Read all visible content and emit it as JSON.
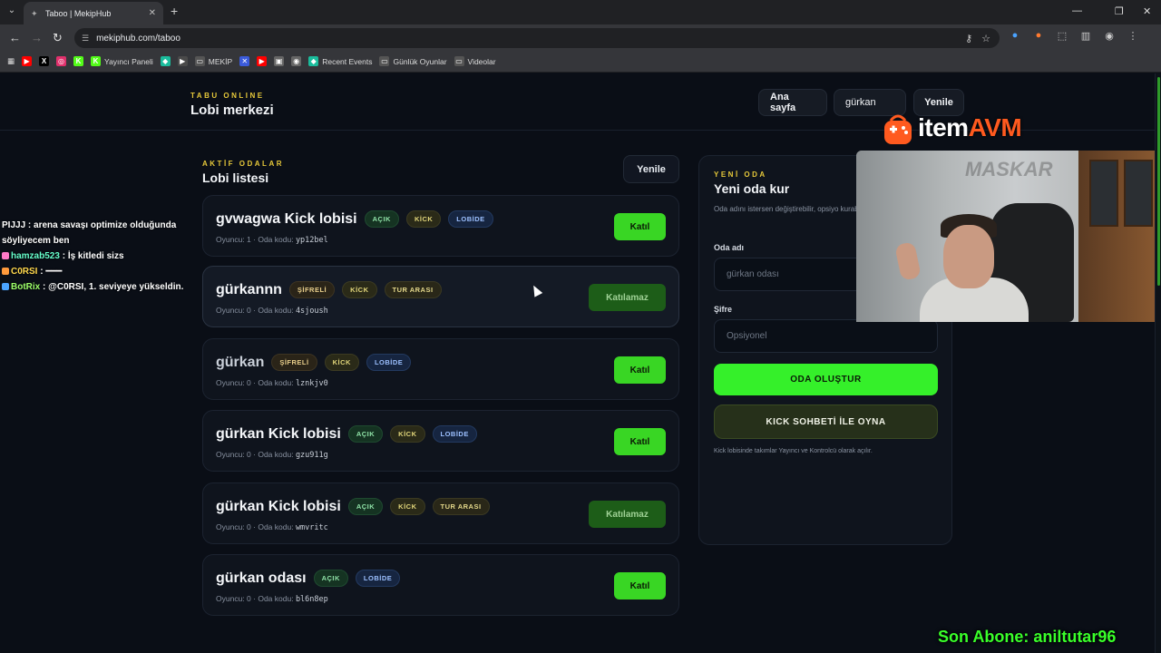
{
  "browser": {
    "tab_title": "Taboo | MekipHub",
    "url": "mekiphub.com/taboo",
    "bookmarks": [
      {
        "label": "",
        "color": "#ff0000",
        "glyph": "▶"
      },
      {
        "label": "",
        "color": "#000000",
        "glyph": "X"
      },
      {
        "label": "",
        "color": "#e1306c",
        "glyph": "◎"
      },
      {
        "label": "",
        "color": "#53fc18",
        "glyph": "K"
      },
      {
        "label": "Yayıncı Paneli",
        "color": "#53fc18",
        "glyph": "K"
      },
      {
        "label": "",
        "color": "#1abc9c",
        "glyph": "◆"
      },
      {
        "label": "",
        "color": "#4a4a4a",
        "glyph": "▶"
      },
      {
        "label": "MEKİP",
        "color": "#555555",
        "glyph": "▭"
      },
      {
        "label": "",
        "color": "#3b5bdb",
        "glyph": "✕"
      },
      {
        "label": "",
        "color": "#ff0000",
        "glyph": "▶"
      },
      {
        "label": "",
        "color": "#666666",
        "glyph": "▣"
      },
      {
        "label": "",
        "color": "#666666",
        "glyph": "◉"
      },
      {
        "label": "Recent Events",
        "color": "#1abc9c",
        "glyph": "◆"
      },
      {
        "label": "Günlük Oyunlar",
        "color": "#555555",
        "glyph": "▭"
      },
      {
        "label": "Videolar",
        "color": "#555555",
        "glyph": "▭"
      }
    ]
  },
  "header": {
    "eyebrow": "TABU ONLINE",
    "title": "Lobi merkezi",
    "home_label": "Ana sayfa",
    "user_label": "gürkan",
    "refresh_label": "Yenile"
  },
  "lobby": {
    "eyebrow": "AKTİF ODALAR",
    "title": "Lobi listesi",
    "refresh_label": "Yenile",
    "player_label": "Oyuncu:",
    "code_label": "Oda kodu:",
    "rooms": [
      {
        "name": "gvwagwa Kick lobisi",
        "badges": [
          "AÇIK",
          "KİCK",
          "LOBİDE"
        ],
        "players": "1",
        "code": "yp12bel",
        "action": "Katıl",
        "joinable": true
      },
      {
        "name": "gürkannn",
        "badges": [
          "ŞİFRELİ",
          "KİCK",
          "TUR ARASI"
        ],
        "players": "0",
        "code": "4sjoush",
        "action": "Katılamaz",
        "joinable": false
      },
      {
        "name": "gürkan",
        "badges": [
          "ŞİFRELİ",
          "KİCK",
          "LOBİDE"
        ],
        "players": "0",
        "code": "lznkjv0",
        "action": "Katıl",
        "joinable": true
      },
      {
        "name": "gürkan Kick lobisi",
        "badges": [
          "AÇIK",
          "KİCK",
          "LOBİDE"
        ],
        "players": "0",
        "code": "gzu911g",
        "action": "Katıl",
        "joinable": true
      },
      {
        "name": "gürkan Kick lobisi",
        "badges": [
          "AÇIK",
          "KİCK",
          "TUR ARASI"
        ],
        "players": "0",
        "code": "wmvritc",
        "action": "Katılamaz",
        "joinable": false
      },
      {
        "name": "gürkan odası",
        "badges": [
          "AÇIK",
          "LOBİDE"
        ],
        "players": "0",
        "code": "bl6n8ep",
        "action": "Katıl",
        "joinable": true
      }
    ]
  },
  "new_room": {
    "eyebrow": "YENİ ODA",
    "title": "Yeni oda kur",
    "description": "Oda adını istersen değiştirebilir, opsiyo kurabilirsin.",
    "name_label": "Oda adı",
    "name_placeholder": "gürkan odası",
    "password_label": "Şifre",
    "password_placeholder": "Opsiyonel",
    "create_label": "ODA OLUŞTUR",
    "kick_label": "KICK SOHBETİ İLE OYNA",
    "footnote": "Kick lobisinde takımlar Yayıncı ve Kontrolcü olarak açılır."
  },
  "overlay": {
    "chat": [
      {
        "user": "PIJJJ",
        "text": "arena savaşı optimize olduğunda söyliyecem ben"
      },
      {
        "user": "hamzab523",
        "text": "İş kitledi sizs"
      },
      {
        "user": "C0RSI",
        "text": "━━━"
      },
      {
        "user": "BotRix",
        "text": "@C0RSI, 1. seviyeye yükseldin."
      }
    ],
    "sponsor_prefix": "item",
    "sponsor_suffix": "AVM",
    "webcam_watermark": "MASKAR",
    "sub_alert": "Son Abone: aniltutar96"
  }
}
